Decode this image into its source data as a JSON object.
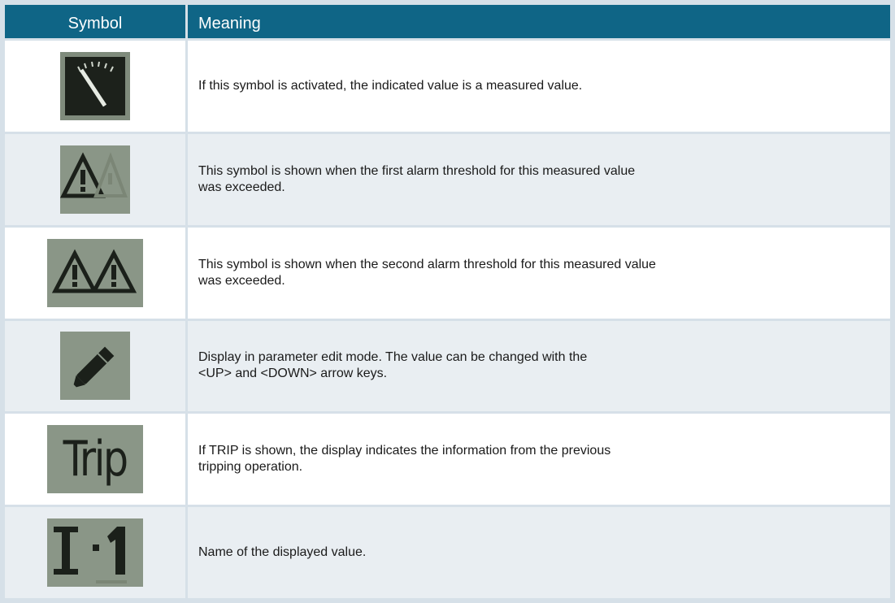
{
  "header": {
    "symbol": "Symbol",
    "meaning": "Meaning"
  },
  "rows": [
    {
      "icon": "meter-gauge-icon",
      "meaning": "If this symbol is activated, the indicated value is a measured value."
    },
    {
      "icon": "warning-triangle-icon",
      "meaning": "This symbol is shown when the first alarm threshold for this measured value\nwas exceeded."
    },
    {
      "icon": "double-warning-triangle-icon",
      "meaning": "This symbol is shown when the second alarm threshold for this measured value\nwas exceeded."
    },
    {
      "icon": "pencil-icon",
      "meaning": "Display in parameter edit mode. The value can be changed with the\n<UP> and <DOWN> arrow keys."
    },
    {
      "icon": "trip-text-icon",
      "symbol_text": "Trip",
      "meaning": "If TRIP is shown, the display indicates the information from the previous\ntripping operation."
    },
    {
      "icon": "value-name-i1-icon",
      "symbol_text": "I 1",
      "meaning": "Name of the displayed value."
    }
  ],
  "colors": {
    "header_bg": "#0f6586",
    "lcd_bg": "#8a9687",
    "row_alt_bg": "#e9eef2",
    "frame": "#d6e0e8"
  }
}
